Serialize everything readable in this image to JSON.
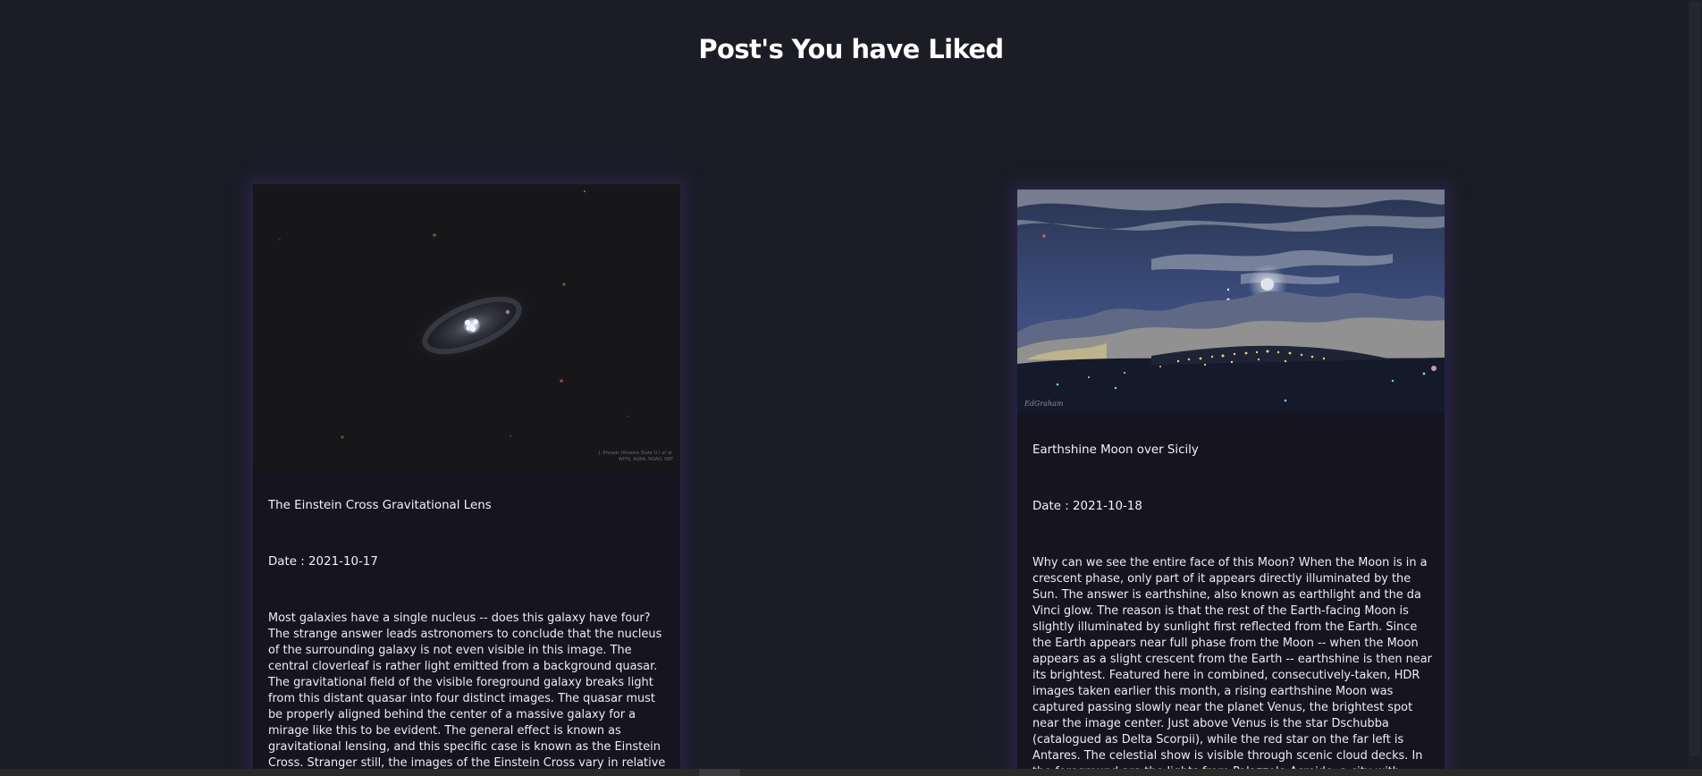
{
  "header": {
    "title": "Post's You have Liked"
  },
  "posts": [
    {
      "title": "The Einstein Cross Gravitational Lens",
      "date": "Date : 2021-10-17",
      "description": "Most galaxies have a single nucleus -- does this galaxy have four? The strange answer leads astronomers to conclude that the nucleus of the surrounding galaxy is not even visible in this image. The central cloverleaf is rather light emitted from a background quasar. The gravitational field of the visible foreground galaxy breaks light from this distant quasar into four distinct images. The quasar must be properly aligned behind the center of a massive galaxy for a mirage like this to be evident. The general effect is known as gravitational lensing, and this specific case is known as the Einstein Cross. Stranger still, the images of the Einstein Cross vary in relative brightness, enhanced occasionally by the additional gravitational",
      "image_credit": "© J. Rhoads (Arizona State U.) et al., WIYN, AURA, NOAO, NSF"
    },
    {
      "title": "Earthshine Moon over Sicily",
      "date": "Date : 2021-10-18",
      "description": "Why can we see the entire face of this Moon? When the Moon is in a crescent phase, only part of it appears directly illuminated by the Sun. The answer is earthshine, also known as earthlight and the da Vinci glow. The reason is that the rest of the Earth-facing Moon is slightly illuminated by sunlight first reflected from the Earth. Since the Earth appears near full phase from the Moon -- when the Moon appears as a slight crescent from the Earth -- earthshine is then near its brightest. Featured here in combined, consecutively-taken, HDR images taken earlier this month, a rising earthshine Moon was captured passing slowly near the planet Venus, the brightest spot near the image center. Just above Venus is the star Dschubba (catalogued as Delta Scorpii), while the red star on the far left is Antares. The celestial show is visible through scenic cloud decks. In the foreground are the lights from Palazzolo Acreide, a city with ancient historical roots in Sicily, Italy."
    }
  ],
  "colors": {
    "page_background": "#1b1c26",
    "card_background": "#16151f",
    "card_glow": "#362e60"
  }
}
